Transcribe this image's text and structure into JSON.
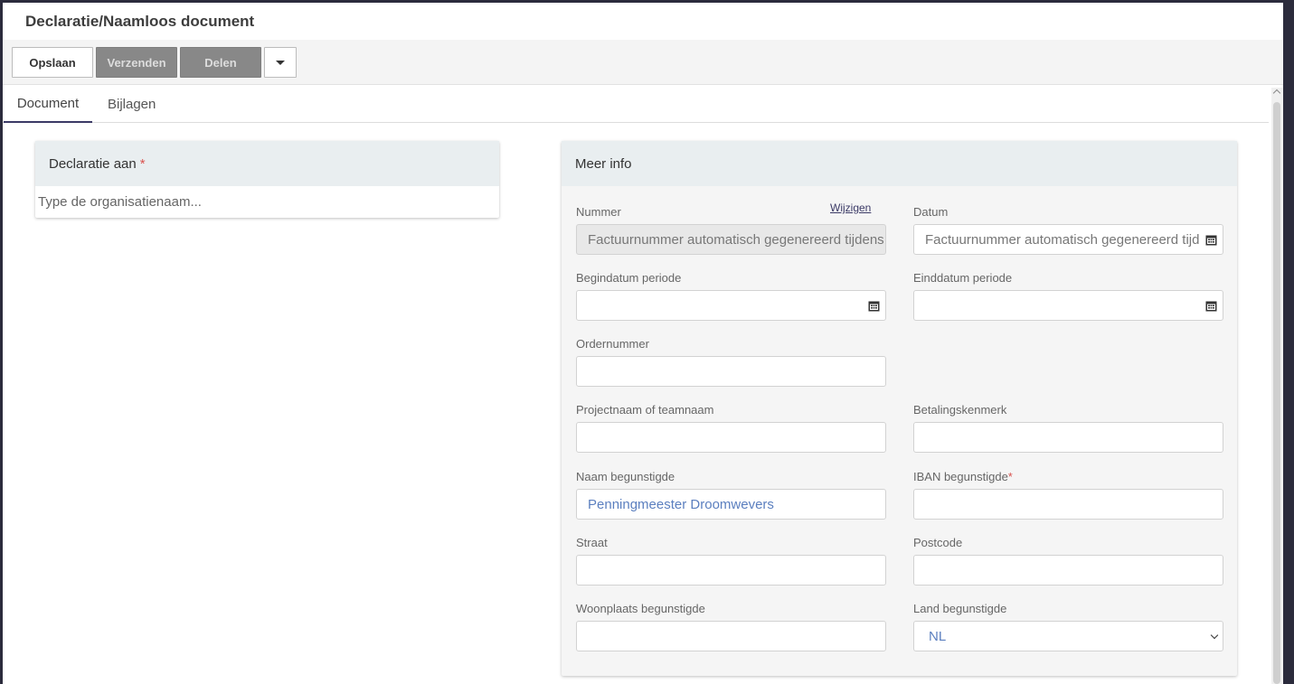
{
  "header": {
    "title": "Declaratie/Naamloos document"
  },
  "toolbar": {
    "save_label": "Opslaan",
    "send_label": "Verzenden",
    "share_label": "Delen"
  },
  "tabs": [
    {
      "label": "Document",
      "active": true
    },
    {
      "label": "Bijlagen",
      "active": false
    }
  ],
  "left_card": {
    "title": "Declaratie aan",
    "required_mark": "*",
    "input_placeholder": "Type de organisatienaam..."
  },
  "right_card": {
    "title": "Meer info",
    "change_link": "Wijzigen",
    "fields": {
      "nummer": {
        "label": "Nummer",
        "value": "Factuurnummer automatisch gegenereerd tijdens verzenden"
      },
      "datum": {
        "label": "Datum",
        "value": "Factuurnummer automatisch gegenereerd tijdens verzenden"
      },
      "begindatum": {
        "label": "Begindatum periode",
        "value": ""
      },
      "einddatum": {
        "label": "Einddatum periode",
        "value": ""
      },
      "ordernummer": {
        "label": "Ordernummer",
        "value": ""
      },
      "projectnaam": {
        "label": "Projectnaam of teamnaam",
        "value": ""
      },
      "betalingskenmerk": {
        "label": "Betalingskenmerk",
        "value": ""
      },
      "naam": {
        "label": "Naam begunstigde",
        "value": "Penningmeester Droomwevers"
      },
      "iban": {
        "label": "IBAN begunstigde",
        "required_mark": "*",
        "value": ""
      },
      "straat": {
        "label": "Straat",
        "value": ""
      },
      "postcode": {
        "label": "Postcode",
        "value": ""
      },
      "woonplaats": {
        "label": "Woonplaats begunstigde",
        "value": ""
      },
      "land": {
        "label": "Land begunstigde",
        "value": "NL"
      }
    }
  },
  "colors": {
    "accent": "#3b3a66",
    "required": "#d9534f",
    "value_text": "#5b7fbf",
    "card_header": "#e9eef0"
  }
}
